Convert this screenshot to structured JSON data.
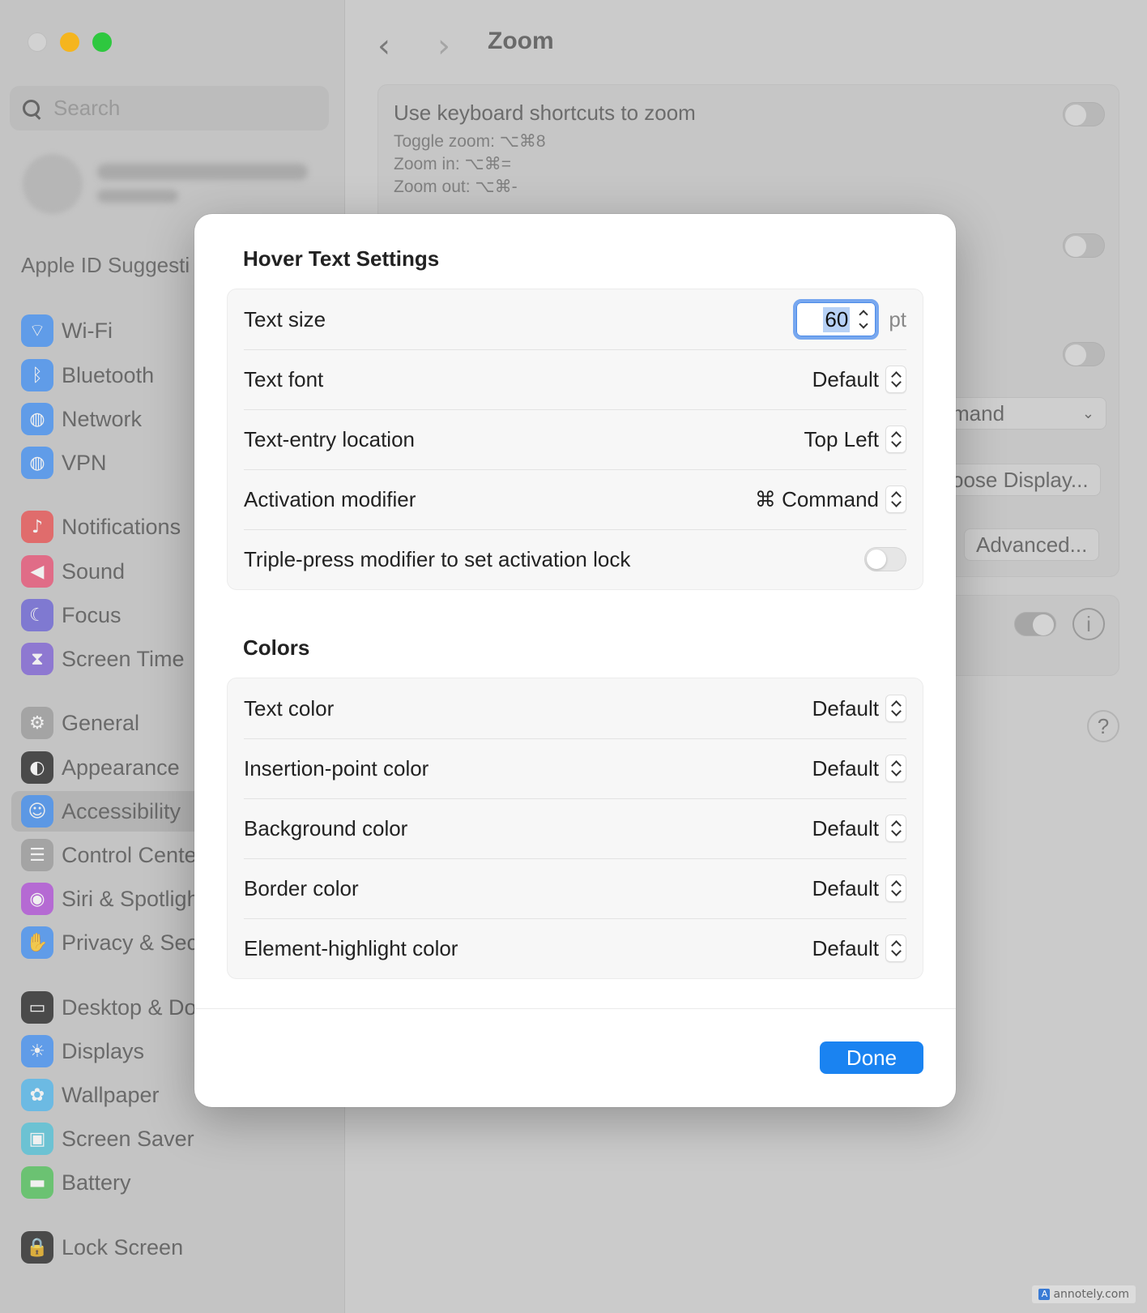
{
  "window": {
    "search": {
      "placeholder": "Search"
    },
    "sidebar": {
      "apple_id_suggestions": "Apple ID Suggesti",
      "items": [
        {
          "label": "Wi-Fi",
          "icon": "wifi-icon",
          "color": "#3f8ff4"
        },
        {
          "label": "Bluetooth",
          "icon": "bluetooth-icon",
          "color": "#3f8ff4"
        },
        {
          "label": "Network",
          "icon": "globe-icon",
          "color": "#3f8ff4"
        },
        {
          "label": "VPN",
          "icon": "vpn-globe-icon",
          "color": "#3f8ff4"
        },
        {
          "label": "Notifications",
          "icon": "bell-icon",
          "color": "#ea4f4f"
        },
        {
          "label": "Sound",
          "icon": "speaker-icon",
          "color": "#ea4f73"
        },
        {
          "label": "Focus",
          "icon": "moon-icon",
          "color": "#6860d6"
        },
        {
          "label": "Screen Time",
          "icon": "hourglass-icon",
          "color": "#7d5fd6"
        },
        {
          "label": "General",
          "icon": "gear-icon",
          "color": "#9a9a9a"
        },
        {
          "label": "Appearance",
          "icon": "appearance-icon",
          "color": "#222222"
        },
        {
          "label": "Accessibility",
          "icon": "accessibility-icon",
          "color": "#3f8ff4"
        },
        {
          "label": "Control Cente",
          "icon": "control-center-icon",
          "color": "#9a9a9a"
        },
        {
          "label": "Siri & Spotligh",
          "icon": "siri-icon",
          "color": "#b04dd8"
        },
        {
          "label": "Privacy & Sec",
          "icon": "hand-icon",
          "color": "#3f8ff4"
        },
        {
          "label": "Desktop & Do",
          "icon": "dock-icon",
          "color": "#222222"
        },
        {
          "label": "Displays",
          "icon": "sun-icon",
          "color": "#3f8ff4"
        },
        {
          "label": "Wallpaper",
          "icon": "flower-icon",
          "color": "#4fb7ee"
        },
        {
          "label": "Screen Saver",
          "icon": "screensaver-icon",
          "color": "#4fc2d9"
        },
        {
          "label": "Battery",
          "icon": "battery-icon",
          "color": "#4ec257"
        },
        {
          "label": "Lock Screen",
          "icon": "lock-icon",
          "color": "#222222"
        }
      ]
    },
    "toolbar": {
      "back": "‹",
      "forward": "›",
      "title": "Zoom"
    },
    "background": {
      "keyboard_shortcuts": "Use keyboard shortcuts to zoom",
      "toggle_zoom": "Toggle zoom: ⌥⌘8",
      "zoom_in": "Zoom in: ⌥⌘=",
      "zoom_out": "Zoom out: ⌥⌘-",
      "modifier_partial": "mand",
      "choose_display": "oose Display...",
      "advanced": "Advanced...",
      "info": "i",
      "help": "?"
    }
  },
  "sheet": {
    "title": "Hover Text Settings",
    "rows": {
      "text_size": {
        "label": "Text size",
        "value": "60",
        "unit": "pt"
      },
      "text_font": {
        "label": "Text font",
        "value": "Default"
      },
      "text_entry_location": {
        "label": "Text-entry location",
        "value": "Top Left"
      },
      "activation_modifier": {
        "label": "Activation modifier",
        "value": "⌘ Command"
      },
      "triple_press": {
        "label": "Triple-press modifier to set activation lock",
        "on": false
      }
    },
    "colors_title": "Colors",
    "colors": [
      {
        "label": "Text color",
        "value": "Default"
      },
      {
        "label": "Insertion-point color",
        "value": "Default"
      },
      {
        "label": "Background color",
        "value": "Default"
      },
      {
        "label": "Border color",
        "value": "Default"
      },
      {
        "label": "Element-highlight color",
        "value": "Default"
      }
    ],
    "done_label": "Done"
  },
  "watermark": "annotely.com"
}
